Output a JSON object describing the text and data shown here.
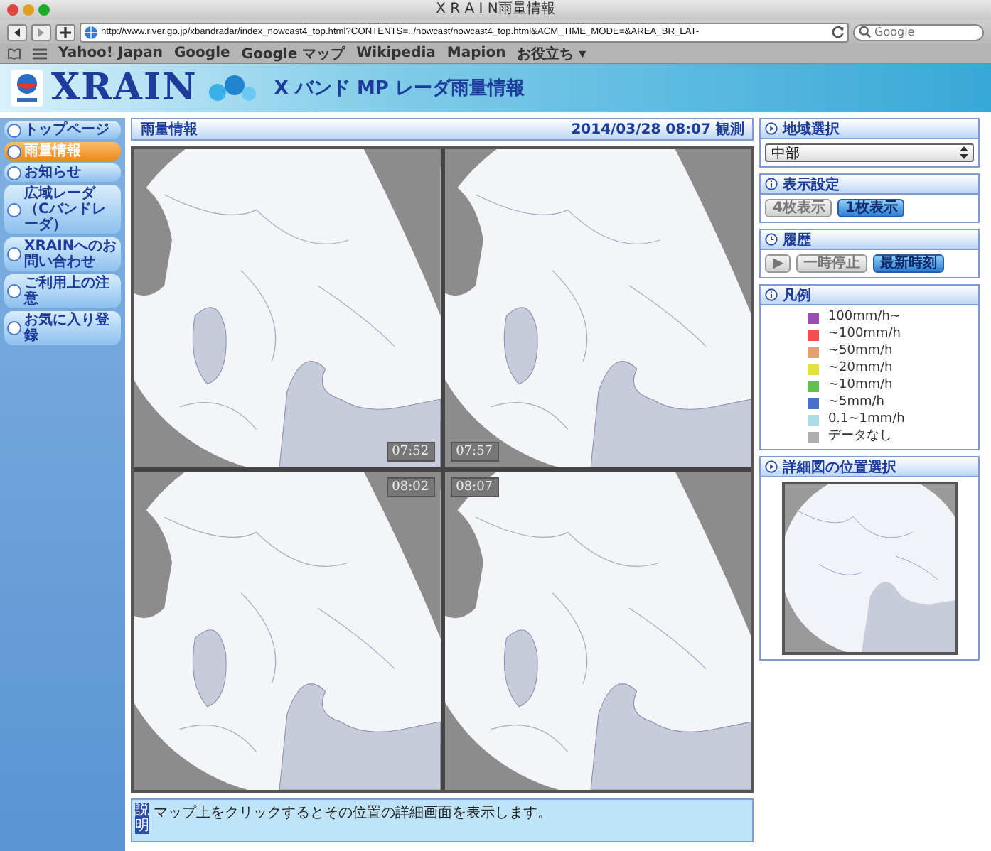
{
  "window": {
    "title": "X R A I N雨量情報"
  },
  "toolbar": {
    "url": "http://www.river.go.jp/xbandradar/index_nowcast4_top.html?CONTENTS=../nowcast/nowcast4_top.html&ACM_TIME_MODE=&AREA_BR_LAT-",
    "search_placeholder": "Google"
  },
  "bookmarks": [
    "Yahoo! Japan",
    "Google",
    "Google マップ",
    "Wikipedia",
    "Mapion",
    "お役立ち ▾"
  ],
  "banner": {
    "logo": "XRAIN",
    "subtitle": "X バンド MP レーダ雨量情報"
  },
  "sidebar": {
    "items": [
      {
        "label": "トップページ",
        "selected": false
      },
      {
        "label": "雨量情報",
        "selected": true
      },
      {
        "label": "お知らせ",
        "selected": false
      },
      {
        "label": "広域レーダ（Cバンドレーダ）",
        "selected": false
      },
      {
        "label": "XRAINへのお問い合わせ",
        "selected": false
      },
      {
        "label": "ご利用上の注意",
        "selected": false
      },
      {
        "label": "お気に入り登録",
        "selected": false
      }
    ]
  },
  "main": {
    "title": "雨量情報",
    "observed": "2014/03/28 08:07 観測",
    "maps": [
      {
        "time": "07:52"
      },
      {
        "time": "07:57"
      },
      {
        "time": "08:02"
      },
      {
        "time": "08:07"
      }
    ],
    "description": {
      "tag": "説明",
      "text": "マップ上をクリックするとその位置の詳細画面を表示します。"
    }
  },
  "panels": {
    "region": {
      "title": "地域選択",
      "value": "中部"
    },
    "display": {
      "title": "表示設定",
      "buttons": [
        {
          "label": "4枚表示",
          "disabled": true
        },
        {
          "label": "1枚表示",
          "disabled": false
        }
      ]
    },
    "history": {
      "title": "履歴",
      "buttons": [
        {
          "label": "▶",
          "disabled": true
        },
        {
          "label": "一時停止",
          "disabled": true
        },
        {
          "label": "最新時刻",
          "disabled": false
        }
      ]
    },
    "legend": {
      "title": "凡例",
      "items": [
        {
          "label": "100mm/h~",
          "color": "#9b4fb5"
        },
        {
          "label": "~100mm/h",
          "color": "#f05050"
        },
        {
          "label": "~50mm/h",
          "color": "#e8a070"
        },
        {
          "label": "~20mm/h",
          "color": "#e0e040"
        },
        {
          "label": "~10mm/h",
          "color": "#60c050"
        },
        {
          "label": "~5mm/h",
          "color": "#4a70c8"
        },
        {
          "label": "0.1~1mm/h",
          "color": "#a8dde8"
        },
        {
          "label": "データなし",
          "color": "#b0b0b0"
        }
      ]
    },
    "position": {
      "title": "詳細図の位置選択"
    }
  }
}
